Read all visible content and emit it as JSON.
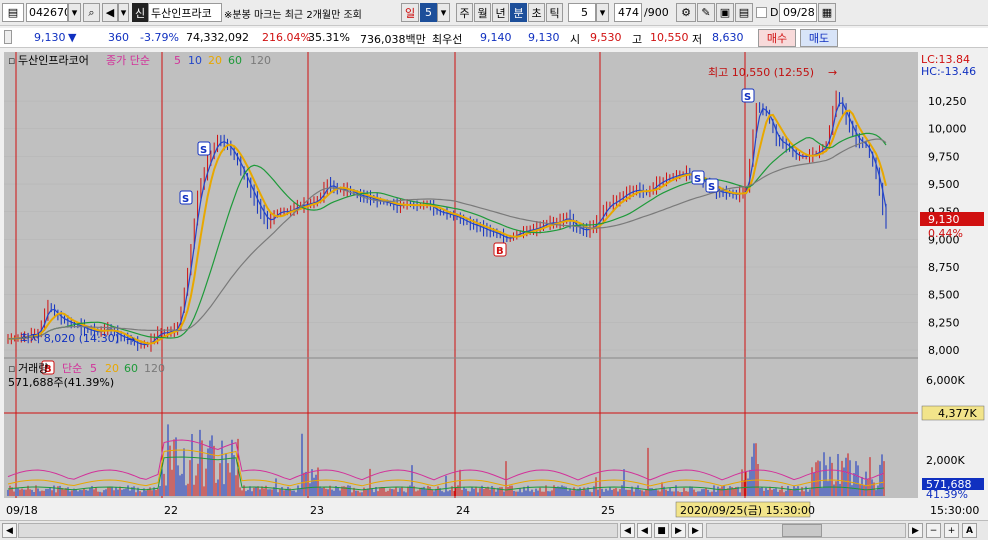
{
  "toolbar": {
    "code": "042670",
    "name": "두산인프라코",
    "badge": "신",
    "notice": "※분봉 마크는 최근 2개월만 조회",
    "period_day": "일",
    "period_num": "5",
    "tabs": [
      "주",
      "월",
      "년",
      "분",
      "초",
      "틱"
    ],
    "interval": "5",
    "count": "474",
    "count_total": "/900",
    "date": "09/28",
    "d_label": "D"
  },
  "quote": {
    "price": "9,130",
    "change": "360",
    "change_pct": "-3.79%",
    "volume": "74,332,092",
    "vol_ratio": "216.04%",
    "turnover": "35.31%",
    "amount": "736,038백만",
    "best_label": "최우선",
    "best_ask": "9,140",
    "best_bid": "9,130",
    "open_label": "시",
    "open": "9,530",
    "high_label": "고",
    "high": "10,550",
    "low_label": "저",
    "low": "8,630",
    "buy": "매수",
    "sell": "매도"
  },
  "price_panel": {
    "name": "두산인프라코어",
    "indicator": "종가 단순",
    "ma_periods": [
      "5",
      "10",
      "20",
      "60",
      "120"
    ],
    "lc": "LC:13.84",
    "hc": "HC:-13.46",
    "high_annot": "최고 10,550 (12:55)",
    "low_annot": "최저 8,020 (14:30)",
    "y_ticks": [
      "10,250",
      "10,000",
      "9,750",
      "9,500",
      "9,250",
      "9,000",
      "8,750",
      "8,500",
      "8,250",
      "8,000"
    ],
    "last_price": "9,130",
    "last_pct": "0.44%"
  },
  "volume_panel": {
    "name": "거래량",
    "indicator": "단순",
    "ma_periods": [
      "5",
      "20",
      "60",
      "120"
    ],
    "value": "571,688주(41.39%)",
    "y_ticks": [
      "6,000K",
      "4,000K",
      "2,000K"
    ],
    "cursor_value": "4,377K",
    "last_vol": "571,688",
    "last_pct": "41.39%"
  },
  "x_axis": {
    "labels": [
      "09/18",
      "22",
      "23",
      "24",
      "25"
    ],
    "cursor_time": "2020/09/25(금) 15:30:00",
    "end_time": "15:30:00"
  },
  "colors": {
    "ma5": "#d2329a",
    "ma10": "#2145cc",
    "ma20": "#e8a800",
    "ma60": "#1e9a3a",
    "ma120": "#7a7a7a",
    "up": "#d01010",
    "down": "#1030c0",
    "bg": "#c0c0c0"
  },
  "chart_data": {
    "type": "line",
    "series": [
      {
        "name": "price",
        "x": [
          0,
          10,
          20,
          30,
          40,
          50,
          60,
          70,
          80,
          90,
          100,
          110,
          120,
          130,
          140,
          150,
          160,
          170,
          180,
          190,
          200,
          210,
          220,
          230,
          240,
          250,
          260,
          270,
          280,
          290,
          300,
          310,
          320,
          330,
          340,
          350,
          360,
          370,
          380,
          390,
          400,
          410,
          420,
          430,
          440,
          450,
          460,
          470,
          480,
          490,
          500,
          510,
          520,
          530,
          540,
          550,
          560,
          570,
          580,
          590,
          600,
          610,
          620,
          630,
          640,
          650,
          660,
          670,
          680,
          690,
          700,
          710,
          720,
          730,
          740,
          750,
          760,
          770,
          780,
          790,
          800,
          810,
          820,
          830,
          840,
          850,
          860,
          870,
          880
        ],
        "values": [
          8100,
          8110,
          8130,
          8150,
          8400,
          8300,
          8250,
          8220,
          8180,
          8160,
          8200,
          8130,
          8100,
          8050,
          8050,
          8150,
          8160,
          8200,
          8700,
          9400,
          9700,
          9900,
          9850,
          9700,
          9500,
          9300,
          9150,
          9250,
          9250,
          9300,
          9320,
          9350,
          9500,
          9450,
          9450,
          9400,
          9380,
          9350,
          9330,
          9300,
          9320,
          9300,
          9320,
          9250,
          9230,
          9200,
          9150,
          9120,
          9080,
          9050,
          9000,
          9050,
          9080,
          9100,
          9150,
          9150,
          9200,
          9100,
          9080,
          9150,
          9300,
          9350,
          9420,
          9450,
          9420,
          9500,
          9550,
          9580,
          9600,
          9560,
          9500,
          9430,
          9420,
          9400,
          9450,
          10200,
          10150,
          9900,
          9850,
          9750,
          9750,
          9780,
          9850,
          10300,
          10100,
          9900,
          9850,
          9600,
          9130
        ]
      }
    ],
    "ylim": [
      8000,
      10350
    ],
    "y_axis_unit": "KRW",
    "volume_ylim": [
      0,
      7000
    ]
  }
}
